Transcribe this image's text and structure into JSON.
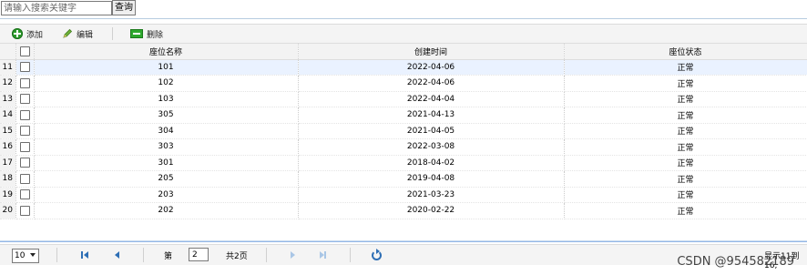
{
  "search": {
    "placeholder": "请输入搜索关键字",
    "button_label": "查询"
  },
  "toolbar": {
    "add_label": "添加",
    "edit_label": "编辑",
    "delete_label": "删除"
  },
  "table": {
    "columns": [
      "座位名称",
      "创建时间",
      "座位状态"
    ],
    "rows": [
      {
        "num": "11",
        "name": "101",
        "created": "2022-04-06",
        "status": "正常"
      },
      {
        "num": "12",
        "name": "102",
        "created": "2022-04-06",
        "status": "正常"
      },
      {
        "num": "13",
        "name": "103",
        "created": "2022-04-04",
        "status": "正常"
      },
      {
        "num": "14",
        "name": "305",
        "created": "2021-04-13",
        "status": "正常"
      },
      {
        "num": "15",
        "name": "304",
        "created": "2021-04-05",
        "status": "正常"
      },
      {
        "num": "16",
        "name": "303",
        "created": "2022-03-08",
        "status": "正常"
      },
      {
        "num": "17",
        "name": "301",
        "created": "2018-04-02",
        "status": "正常"
      },
      {
        "num": "18",
        "name": "205",
        "created": "2019-04-08",
        "status": "正常"
      },
      {
        "num": "19",
        "name": "203",
        "created": "2021-03-23",
        "status": "正常"
      },
      {
        "num": "20",
        "name": "202",
        "created": "2020-02-22",
        "status": "正常"
      }
    ]
  },
  "pager": {
    "page_size": "10",
    "page_label": "第",
    "current_page": "2",
    "total_label": "共2页",
    "display_info": "显示11到16,"
  },
  "watermark": "CSDN @954582189",
  "colors": {
    "accent": "#2e6fb5",
    "selected_row": "#eaf2ff",
    "add_icon": "#2a9a2a"
  },
  "icons": [
    "add-icon",
    "edit-icon",
    "delete-icon",
    "first-page-icon",
    "prev-page-icon",
    "next-page-icon",
    "last-page-icon",
    "refresh-icon"
  ]
}
